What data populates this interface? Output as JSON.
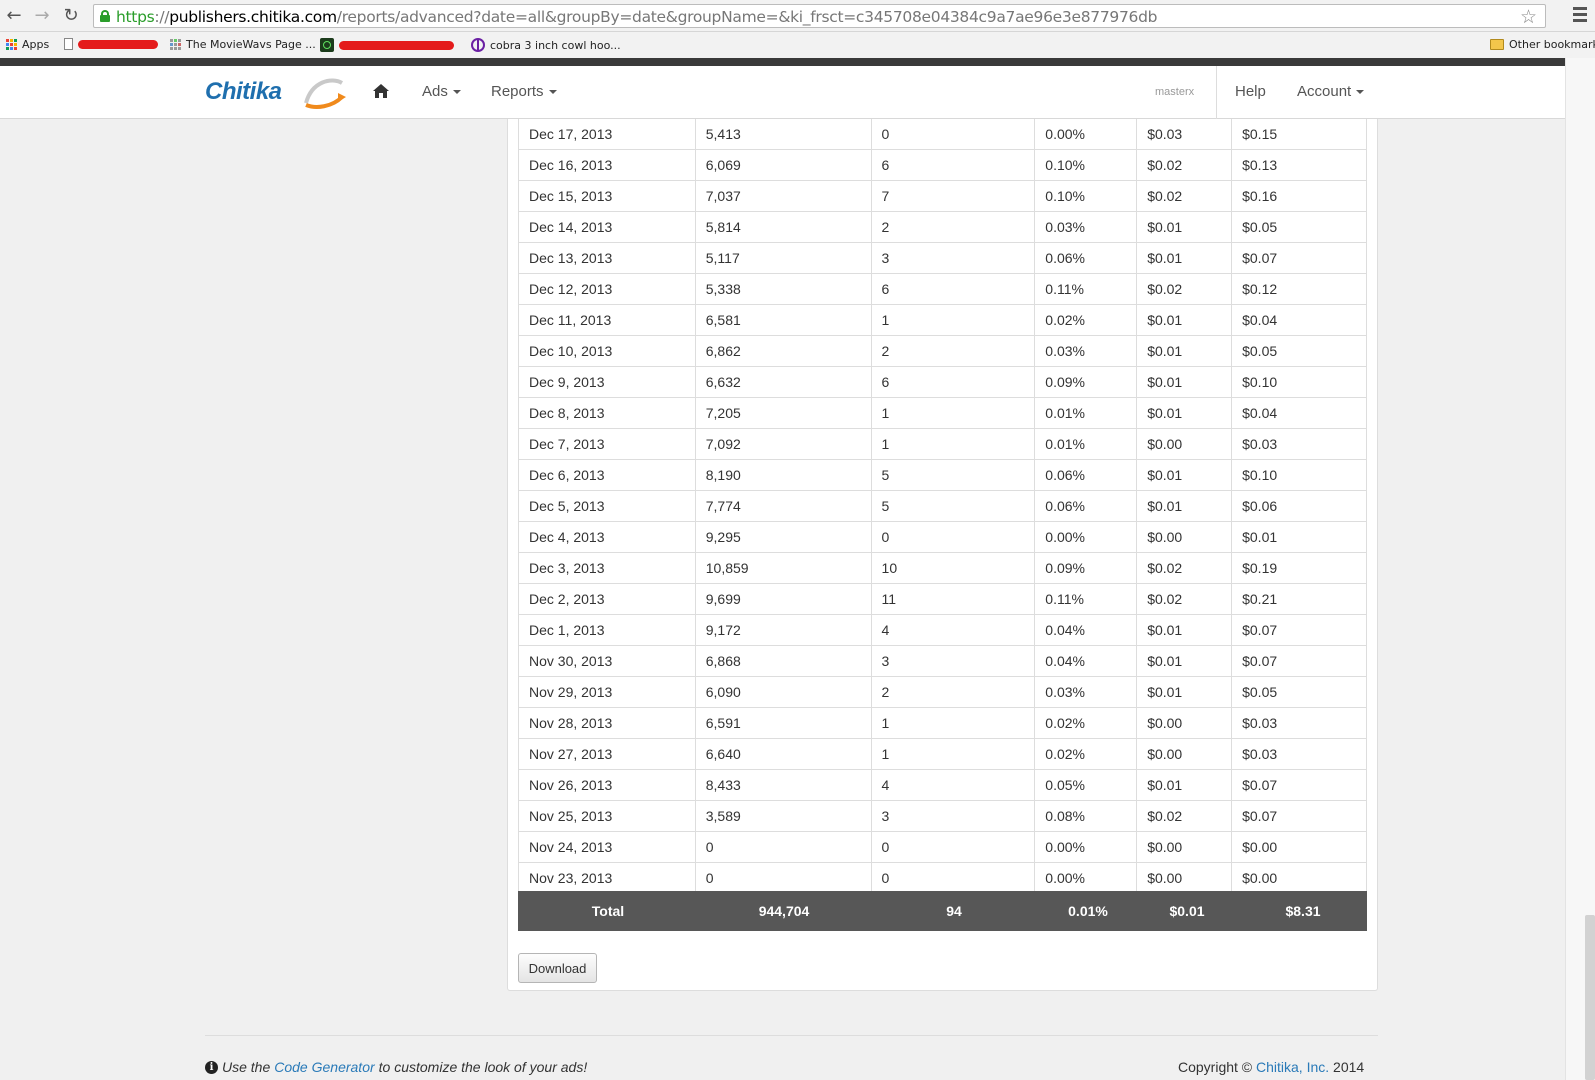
{
  "browser": {
    "url_scheme": "https",
    "url_sep": "://",
    "url_host": "publishers.chitika.com",
    "url_path": "/reports/advanced?date=all&groupBy=date&groupName=&ki_frsct=c345708e04384c9a7ae96e3e877976db",
    "bookmarks": {
      "apps": "Apps",
      "moviewavs": "The MovieWavs Page ...",
      "cobra": "cobra 3 inch cowl hoo...",
      "other": "Other bookmarks"
    }
  },
  "site": {
    "logo": "Chitika",
    "nav": {
      "ads": "Ads",
      "reports": "Reports",
      "user": "masterx",
      "help": "Help",
      "account": "Account"
    }
  },
  "report": {
    "rows": [
      [
        "Dec 17, 2013",
        "5,413",
        "0",
        "0.00%",
        "$0.03",
        "$0.15"
      ],
      [
        "Dec 16, 2013",
        "6,069",
        "6",
        "0.10%",
        "$0.02",
        "$0.13"
      ],
      [
        "Dec 15, 2013",
        "7,037",
        "7",
        "0.10%",
        "$0.02",
        "$0.16"
      ],
      [
        "Dec 14, 2013",
        "5,814",
        "2",
        "0.03%",
        "$0.01",
        "$0.05"
      ],
      [
        "Dec 13, 2013",
        "5,117",
        "3",
        "0.06%",
        "$0.01",
        "$0.07"
      ],
      [
        "Dec 12, 2013",
        "5,338",
        "6",
        "0.11%",
        "$0.02",
        "$0.12"
      ],
      [
        "Dec 11, 2013",
        "6,581",
        "1",
        "0.02%",
        "$0.01",
        "$0.04"
      ],
      [
        "Dec 10, 2013",
        "6,862",
        "2",
        "0.03%",
        "$0.01",
        "$0.05"
      ],
      [
        "Dec 9, 2013",
        "6,632",
        "6",
        "0.09%",
        "$0.01",
        "$0.10"
      ],
      [
        "Dec 8, 2013",
        "7,205",
        "1",
        "0.01%",
        "$0.01",
        "$0.04"
      ],
      [
        "Dec 7, 2013",
        "7,092",
        "1",
        "0.01%",
        "$0.00",
        "$0.03"
      ],
      [
        "Dec 6, 2013",
        "8,190",
        "5",
        "0.06%",
        "$0.01",
        "$0.10"
      ],
      [
        "Dec 5, 2013",
        "7,774",
        "5",
        "0.06%",
        "$0.01",
        "$0.06"
      ],
      [
        "Dec 4, 2013",
        "9,295",
        "0",
        "0.00%",
        "$0.00",
        "$0.01"
      ],
      [
        "Dec 3, 2013",
        "10,859",
        "10",
        "0.09%",
        "$0.02",
        "$0.19"
      ],
      [
        "Dec 2, 2013",
        "9,699",
        "11",
        "0.11%",
        "$0.02",
        "$0.21"
      ],
      [
        "Dec 1, 2013",
        "9,172",
        "4",
        "0.04%",
        "$0.01",
        "$0.07"
      ],
      [
        "Nov 30, 2013",
        "6,868",
        "3",
        "0.04%",
        "$0.01",
        "$0.07"
      ],
      [
        "Nov 29, 2013",
        "6,090",
        "2",
        "0.03%",
        "$0.01",
        "$0.05"
      ],
      [
        "Nov 28, 2013",
        "6,591",
        "1",
        "0.02%",
        "$0.00",
        "$0.03"
      ],
      [
        "Nov 27, 2013",
        "6,640",
        "1",
        "0.02%",
        "$0.00",
        "$0.03"
      ],
      [
        "Nov 26, 2013",
        "8,433",
        "4",
        "0.05%",
        "$0.01",
        "$0.07"
      ],
      [
        "Nov 25, 2013",
        "3,589",
        "3",
        "0.08%",
        "$0.02",
        "$0.07"
      ],
      [
        "Nov 24, 2013",
        "0",
        "0",
        "0.00%",
        "$0.00",
        "$0.00"
      ],
      [
        "Nov 23, 2013",
        "0",
        "0",
        "0.00%",
        "$0.00",
        "$0.00"
      ]
    ],
    "total": {
      "label": "Total",
      "impressions": "944,704",
      "clicks": "94",
      "ctr": "0.01%",
      "ecpm": "$0.01",
      "revenue": "$8.31"
    },
    "download_label": "Download"
  },
  "footer": {
    "use_the": "Use the",
    "code_generator": "Code Generator",
    "tip_rest": "to customize the look of your ads!",
    "copyright": "Copyright ©",
    "company": "Chitika, Inc.",
    "year": "2014"
  },
  "colors": {
    "brand_blue": "#1f6fae",
    "link": "#2a7ab8",
    "total_bg": "#575757",
    "ssl_green": "#2a9d2a"
  },
  "icons": [
    "back-arrow-icon",
    "forward-arrow-icon",
    "reload-icon",
    "lock-icon",
    "star-icon",
    "chrome-menu-icon",
    "apps-grid-icon",
    "home-icon",
    "info-icon"
  ]
}
